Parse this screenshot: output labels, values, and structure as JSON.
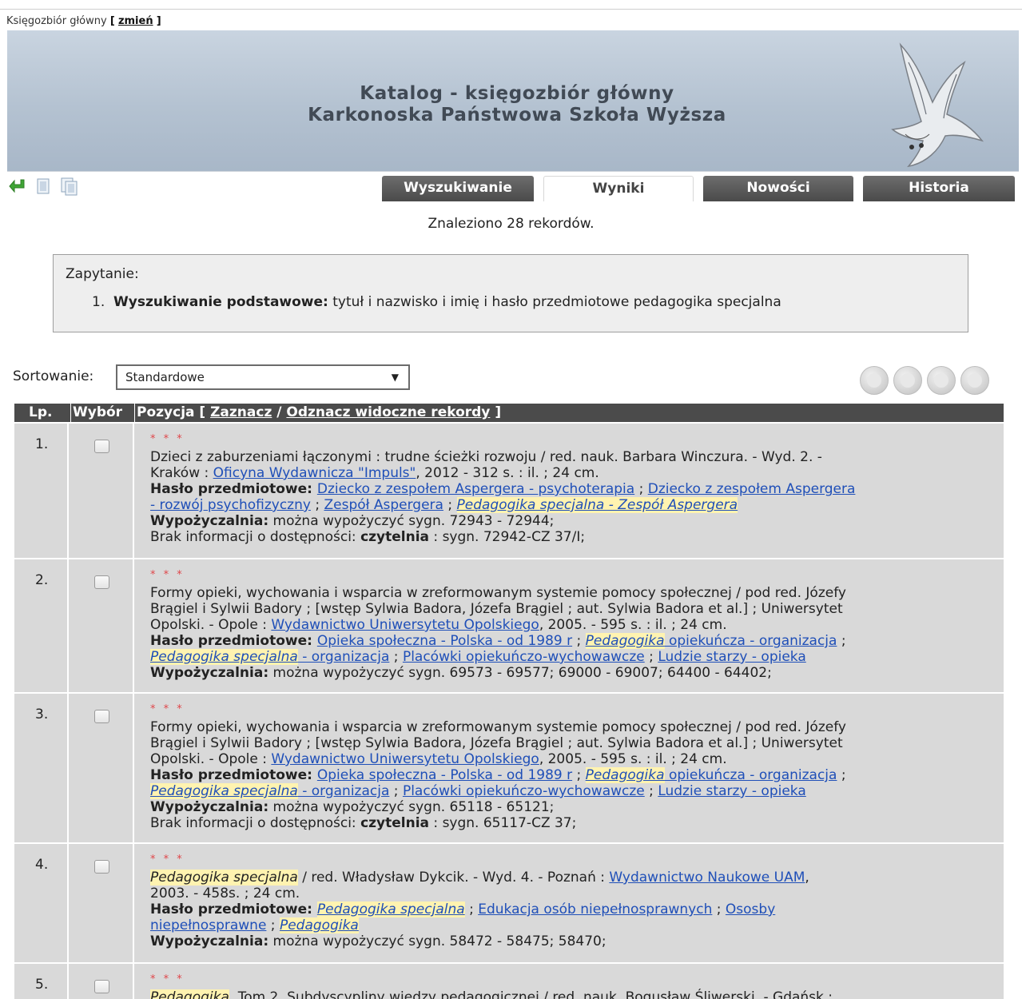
{
  "collection": {
    "label": "Księgozbiór główny",
    "open": "[",
    "link": "zmień",
    "close": "]"
  },
  "header": {
    "title1": "Katalog - księgozbiór główny",
    "title2": "Karkonoska Państwowa Szkoła Wyższa"
  },
  "tabs": [
    {
      "label": "Wyszukiwanie"
    },
    {
      "label": "Wyniki"
    },
    {
      "label": "Nowości"
    },
    {
      "label": "Historia"
    }
  ],
  "found": "Znaleziono 28 rekordów.",
  "query": {
    "label": "Zapytanie:",
    "num": "1.",
    "bold": "Wyszukiwanie podstawowe:",
    "text": " tytuł i nazwisko i imię i hasło przedmiotowe pedagogika specjalna"
  },
  "sort": {
    "label": "Sortowanie:",
    "value": "Standardowe"
  },
  "table_head": {
    "lp": "Lp.",
    "wybor": "Wybór",
    "pozycja": "Pozycja [",
    "zaznacz": "Zaznacz",
    "slash": "/",
    "odznacz": "Odznacz widoczne rekordy",
    "close": "]"
  },
  "stars": "* * *",
  "rows": [
    {
      "lp": "1.",
      "l1": "Dzieci z zaburzeniami łączonymi : trudne ścieżki rozwoju / red. nauk. Barbara Winczura. - Wyd. 2. -",
      "l2a": "Kraków : ",
      "l2link": "Oficyna Wydawnicza \"Impuls\"",
      "l2b": ", 2012 - 312 s. : il. ; 24 cm.",
      "hlabel": "Hasło przedmiotowe: ",
      "h1": "Dziecko z zespołem Aspergera - psychoterapia",
      "sep": " ; ",
      "h2a": "Dziecko z zespołem Aspergera",
      "h2b": "- rozwój psychofizyczny",
      "h3": "Zespół Aspergera",
      "h4": "Pedagogika specjalna - Zespół Aspergera",
      "wlabel": "Wypożyczalnia:",
      "wtext": " można wypożyczyć sygn. 72943 - 72944;",
      "blabel": "Brak informacji o dostępności: ",
      "bbold": "czytelnia",
      "btext": " : sygn. 72942-CZ 37/I;"
    },
    {
      "lp": "2.",
      "l1": "Formy opieki, wychowania i wsparcia w zreformowanym systemie pomocy społecznej / pod red. Józefy",
      "l2": "Brągiel i Sylwii Badory ; [wstęp Sylwia Badora, Józefa Brągiel ; aut. Sylwia Badora et al.] ; Uniwersytet",
      "l3a": "Opolski. - Opole : ",
      "l3link": "Wydawnictwo Uniwersytetu Opolskiego",
      "l3b": ", 2005. - 595 s. : il. ; 24 cm.",
      "hlabel": "Hasło przedmiotowe: ",
      "h1": "Opieka społeczna - Polska - od 1989 r",
      "sep": " ; ",
      "h2hl": "Pedagogika",
      "h2": " opiekuńcza - organizacja",
      "h3hl": "Pedagogika specjalna",
      "h3": " - organizacja",
      "h4": "Placówki opiekuńczo-wychowawcze",
      "h5": "Ludzie starzy - opieka",
      "wlabel": "Wypożyczalnia:",
      "wtext": " można wypożyczyć sygn. 69573 - 69577; 69000 - 69007; 64400 - 64402;"
    },
    {
      "lp": "3.",
      "l1": "Formy opieki, wychowania i wsparcia w zreformowanym systemie pomocy społecznej / pod red. Józefy",
      "l2": "Brągiel i Sylwii Badory ; [wstęp Sylwia Badora, Józefa Brągiel ; aut. Sylwia Badora et al.] ; Uniwersytet",
      "l3a": "Opolski. - Opole : ",
      "l3link": "Wydawnictwo Uniwersytetu Opolskiego",
      "l3b": ", 2005. - 595 s. : il. ; 24 cm.",
      "hlabel": "Hasło przedmiotowe: ",
      "h1": "Opieka społeczna - Polska - od 1989 r",
      "sep": " ; ",
      "h2hl": "Pedagogika",
      "h2": " opiekuńcza - organizacja",
      "h3hl": "Pedagogika specjalna",
      "h3": " - organizacja",
      "h4": "Placówki opiekuńczo-wychowawcze",
      "h5": "Ludzie starzy - opieka",
      "wlabel": "Wypożyczalnia:",
      "wtext": " można wypożyczyć sygn. 65118 - 65121;",
      "blabel": "Brak informacji o dostępności: ",
      "bbold": "czytelnia",
      "btext": " : sygn. 65117-CZ 37;"
    },
    {
      "lp": "4.",
      "l1hl": "Pedagogika specjalna",
      "l1a": " / red. Władysław Dykcik. - Wyd. 4. - Poznań : ",
      "l1link": "Wydawnictwo Naukowe UAM",
      "l1b": ",",
      "l2": "2003. - 458s. ; 24 cm.",
      "hlabel": "Hasło przedmiotowe: ",
      "h1hl": "Pedagogika specjalna",
      "sep": " ; ",
      "h2": "Edukacja osób niepełnosprawnych",
      "h3a": "Ososby",
      "h3b": "niepełnosprawne",
      "h4hl": "Pedagogika",
      "wlabel": "Wypożyczalnia:",
      "wtext": " można wypożyczyć sygn. 58472 - 58475; 58470;"
    },
    {
      "lp": "5.",
      "l1hl": "Pedagogika",
      "l1": ". Tom 2, Subdyscypliny wiedzy pedagogicznej / red. nauk. Bogusław Śliwerski. - Gdańsk :"
    }
  ]
}
